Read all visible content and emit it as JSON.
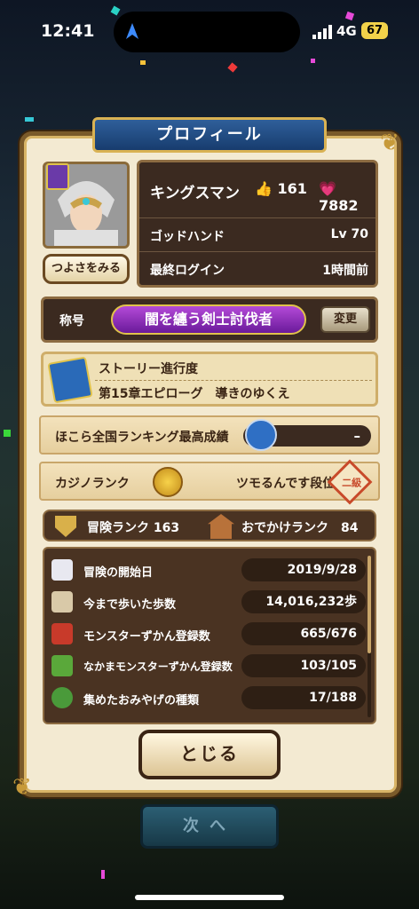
{
  "status": {
    "time": "12:41",
    "network": "4G",
    "battery": "67"
  },
  "panel": {
    "title": "プロフィール"
  },
  "profile": {
    "name": "キングスマン",
    "likes": "161",
    "hearts": "7882",
    "job": "ゴッドハンド",
    "level": "Lv 70",
    "last_login_label": "最終ログイン",
    "last_login_value": "1時間前",
    "strength_button": "つよさをみる"
  },
  "shogo": {
    "label": "称号",
    "value": "闇を纏う剣士討伐者",
    "change_button": "変更"
  },
  "story": {
    "label": "ストーリー進行度",
    "chapter": "第15章エピローグ　導きのゆくえ"
  },
  "hokora": {
    "label": "ほこら全国ランキング最高成績",
    "value": "–"
  },
  "casino": {
    "label": "カジノランク",
    "coin_text": "ツモるんです",
    "rank_text": "ツモるんです段位",
    "badge": "二級"
  },
  "adventure": {
    "rank_text": "冒険ランク 163",
    "odekake_text": "おでかけランク　84"
  },
  "stats": [
    {
      "label": "冒険の開始日",
      "value": "2019/9/28",
      "icon": "wing-icon",
      "color": "#e8e8f0"
    },
    {
      "label": "今まで歩いた歩数",
      "value": "14,016,232歩",
      "icon": "footprints-icon",
      "color": "#d9c9a8"
    },
    {
      "label": "モンスターずかん登録数",
      "value": "665/676",
      "icon": "red-book-icon",
      "color": "#c83a2a"
    },
    {
      "label": "なかまモンスターずかん登録数",
      "value": "103/105",
      "icon": "green-book-icon",
      "color": "#5aa83a"
    },
    {
      "label": "集めたおみやげの種類",
      "value": "17/188",
      "icon": "leaf-icon",
      "color": "#4a9a3a"
    }
  ],
  "buttons": {
    "close": "とじる",
    "next": "次へ"
  }
}
